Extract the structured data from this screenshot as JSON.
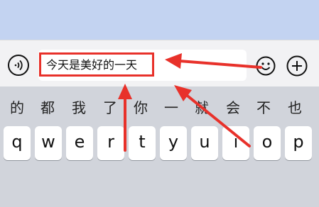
{
  "input_bar": {
    "text_value": "今天是美好的一天"
  },
  "candidates": [
    "的",
    "都",
    "我",
    "了",
    "你",
    "一",
    "就",
    "会",
    "不",
    "也"
  ],
  "keys_row1": [
    "q",
    "w",
    "e",
    "r",
    "t",
    "y",
    "u",
    "i",
    "o",
    "p"
  ],
  "colors": {
    "highlight": "#e8312a",
    "arrow": "#e8312a",
    "keyboard_bg": "#d1d4db",
    "top_bg": "#c3d3f1"
  },
  "icons": {
    "voice": "voice-icon",
    "emoji": "emoji-icon",
    "plus": "plus-icon"
  }
}
